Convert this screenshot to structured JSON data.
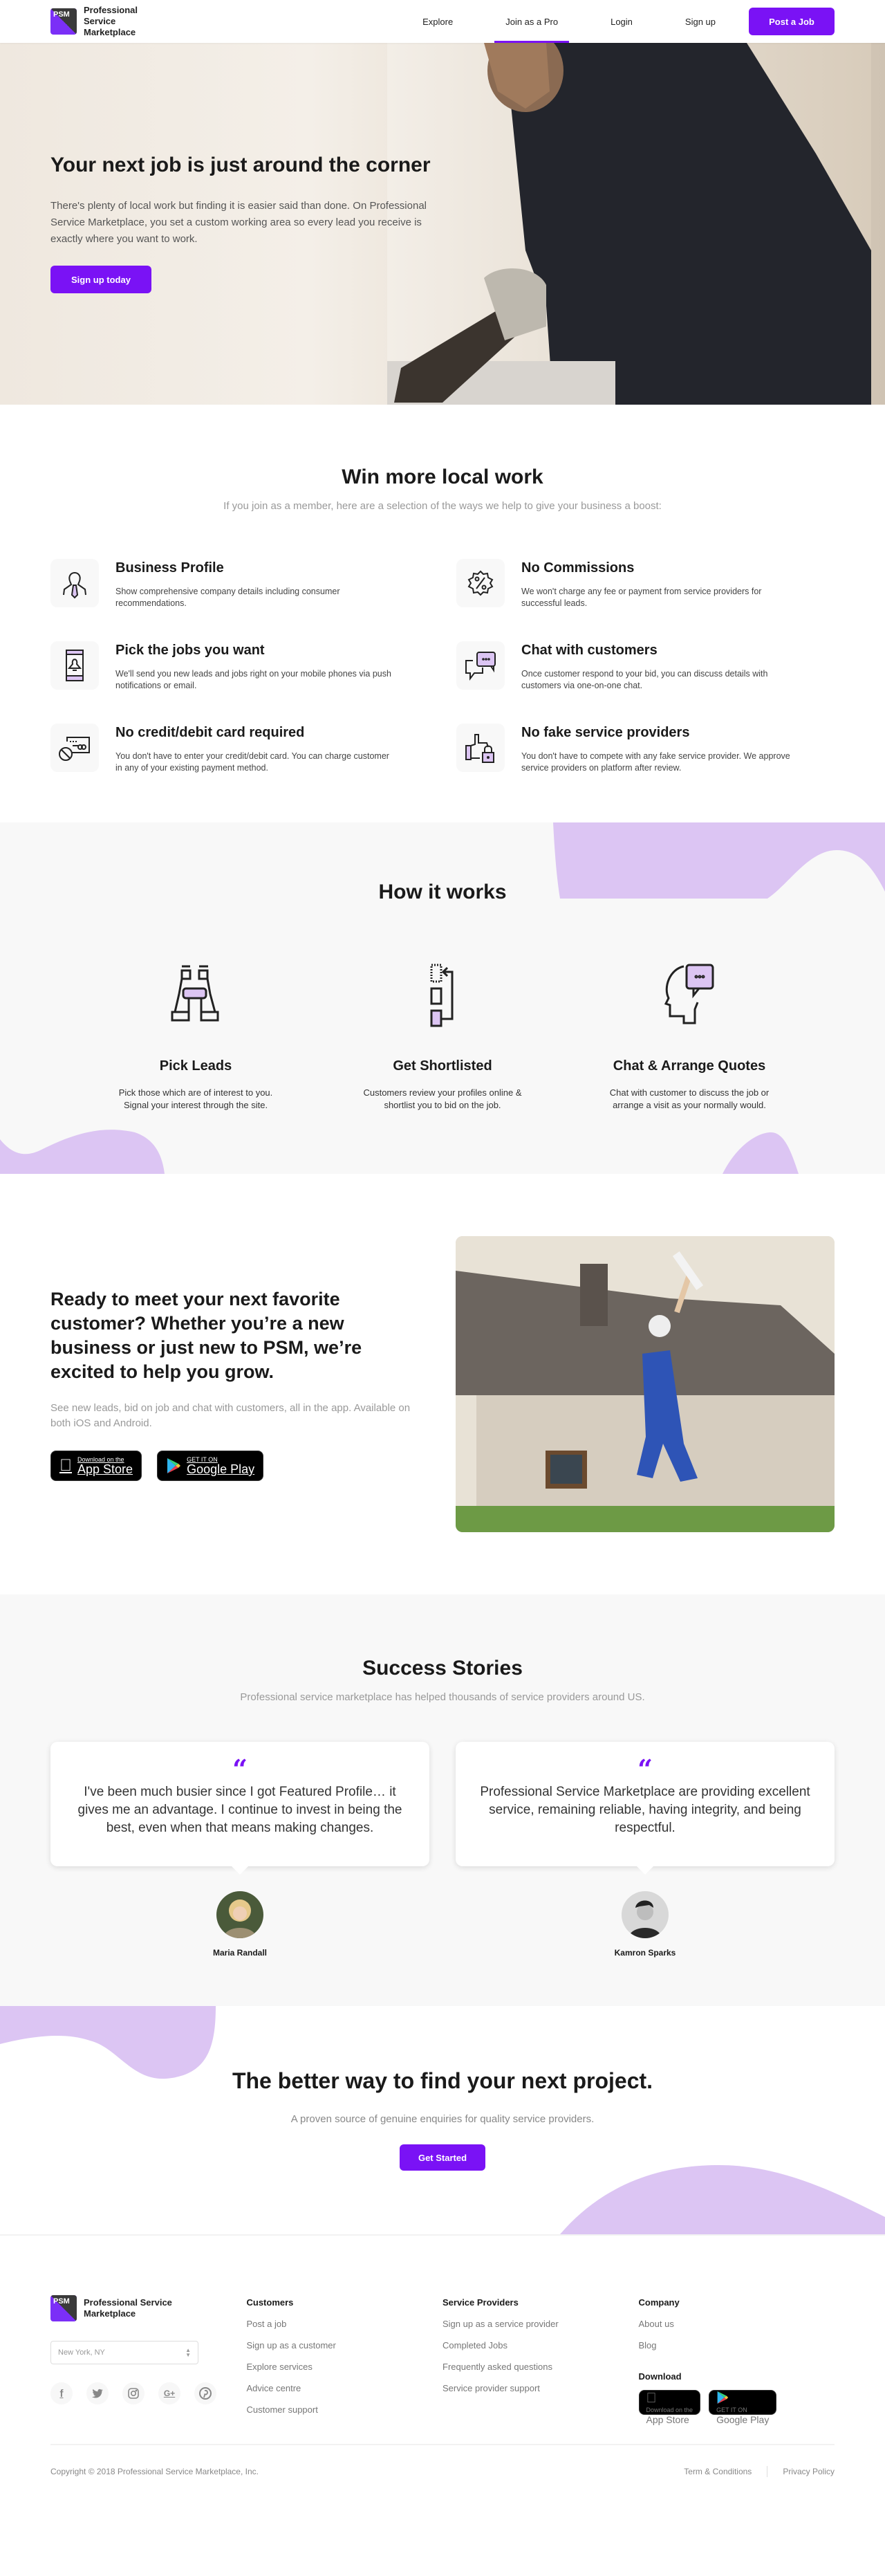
{
  "header": {
    "logo_mark": "PSM",
    "logo_text": "Professional Service Marketplace",
    "nav": [
      {
        "label": "Explore",
        "active": false
      },
      {
        "label": "Join as a Pro",
        "active": true
      },
      {
        "label": "Login",
        "active": false
      },
      {
        "label": "Sign up",
        "active": false
      }
    ],
    "post_job": "Post a Job"
  },
  "hero": {
    "title": "Your next job is just around the corner",
    "body": "There's plenty of local work but finding it is easier said than done. On Professional Service Marketplace, you set a custom working area so every lead you receive is exactly where you want to work.",
    "cta": "Sign up today"
  },
  "win": {
    "title": "Win more local work",
    "subtitle": "If you join as a member, here are a selection of the ways we help to give your business a boost:",
    "features": [
      {
        "icon": "business-profile-icon",
        "title": "Business Profile",
        "text": "Show comprehensive company details including consumer recommendations."
      },
      {
        "icon": "percent-badge-icon",
        "title": "No Commissions",
        "text": "We won't charge any fee or payment from service providers for successful leads."
      },
      {
        "icon": "mobile-profile-icon",
        "title": "Pick the jobs you want",
        "text": "We'll send you new leads and jobs right on your mobile phones via push notifications or email."
      },
      {
        "icon": "chat-bubbles-icon",
        "title": "Chat with customers",
        "text": "Once customer respond to your bid, you can discuss details with customers via one-on-one chat."
      },
      {
        "icon": "no-card-icon",
        "title": "No credit/debit card required",
        "text": "You don't have to enter your credit/debit card. You can charge customer in any of your existing payment method."
      },
      {
        "icon": "thumbs-up-lock-icon",
        "title": "No fake service providers",
        "text": "You don't have to compete with any fake service provider. We approve service providers on platform after review."
      }
    ]
  },
  "how": {
    "title": "How it works",
    "steps": [
      {
        "icon": "binoculars-icon",
        "title": "Pick Leads",
        "text": "Pick those which are of interest to you. Signal your interest through the site."
      },
      {
        "icon": "shortlist-icon",
        "title": "Get Shortlisted",
        "text": "Customers review your profiles online & shortlist you to bid on the job."
      },
      {
        "icon": "head-chat-icon",
        "title": "Chat & Arrange Quotes",
        "text": "Chat with customer to discuss the job or arrange a visit as your normally would."
      }
    ]
  },
  "app": {
    "title": "Ready to meet your next favorite customer? Whether you’re a new business or just new to PSM, we’re excited to help you grow.",
    "body": "See new leads, bid on job and chat with customers, all in the app. Available on both iOS and Android.",
    "appstore_small": "Download on the",
    "appstore_big": "App Store",
    "play_small": "GET IT ON",
    "play_big": "Google Play"
  },
  "stories": {
    "title": "Success Stories",
    "subtitle": "Professional service marketplace has helped thousands of service providers around US.",
    "quote_mark": "“",
    "items": [
      {
        "quote": "I've been much busier since I got Featured Profile… it gives me an advantage. I continue to invest in being the best, even when that means making changes.",
        "name": "Maria Randall"
      },
      {
        "quote": "Professional Service Marketplace are providing excellent service, remaining reliable, having integrity, and being respectful.",
        "name": "Kamron Sparks"
      }
    ]
  },
  "cta": {
    "title": "The better way to find your next project.",
    "subtitle": "A proven source of genuine enquiries for quality service providers.",
    "button": "Get Started"
  },
  "footer": {
    "logo_mark": "PSM",
    "logo_text": "Professional Service Marketplace",
    "location": "New York, NY",
    "socials": [
      "facebook-icon",
      "twitter-icon",
      "instagram-icon",
      "google-plus-icon",
      "pinterest-icon"
    ],
    "columns": [
      {
        "title": "Customers",
        "links": [
          "Post a job",
          "Sign up as a customer",
          "Explore services",
          "Advice centre",
          "Customer support"
        ]
      },
      {
        "title": "Service Providers",
        "links": [
          "Sign up as a service provider",
          "Completed Jobs",
          "Frequently asked questions",
          "Service provider support"
        ]
      },
      {
        "title": "Company",
        "links": [
          "About us",
          "Blog"
        ]
      }
    ],
    "download_title": "Download",
    "copyright": "Copyright © 2018 Professional Service Marketplace, Inc.",
    "terms": "Term & Conditions",
    "privacy": "Privacy Policy"
  },
  "colors": {
    "accent": "#7a12f5",
    "blob": "#dcc5f3",
    "section_bg": "#f8f8f8"
  }
}
